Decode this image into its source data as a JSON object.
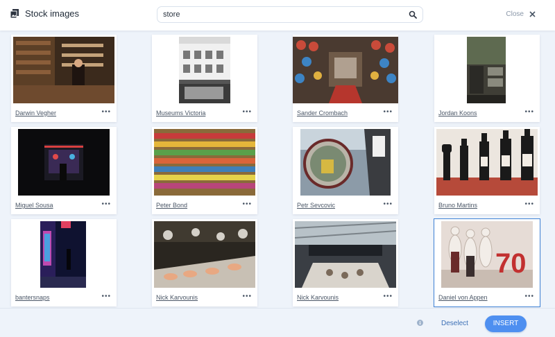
{
  "header": {
    "title": "Stock images",
    "search_value": "store",
    "search_placeholder": "",
    "close_label": "Close"
  },
  "images": [
    {
      "author": "Darwin Vegher",
      "selected": false
    },
    {
      "author": "Museums Victoria",
      "selected": false
    },
    {
      "author": "Sander Crombach",
      "selected": false
    },
    {
      "author": "Jordan Koons",
      "selected": false
    },
    {
      "author": "Miguel Sousa",
      "selected": false
    },
    {
      "author": "Peter Bond",
      "selected": false
    },
    {
      "author": "Petr Sevcovic",
      "selected": false
    },
    {
      "author": "Bruno Martins",
      "selected": false
    },
    {
      "author": "bantersnaps",
      "selected": false
    },
    {
      "author": "Nick Karvounis",
      "selected": false
    },
    {
      "author": "Nick Karvounis",
      "selected": false
    },
    {
      "author": "Daniel von Appen",
      "selected": true
    }
  ],
  "more_label": "•••",
  "footer": {
    "deselect_label": "Deselect",
    "insert_label": "INSERT"
  },
  "colors": {
    "accent": "#4e8ff0",
    "selection_border": "#3f82d6",
    "background": "#eef3fa"
  }
}
